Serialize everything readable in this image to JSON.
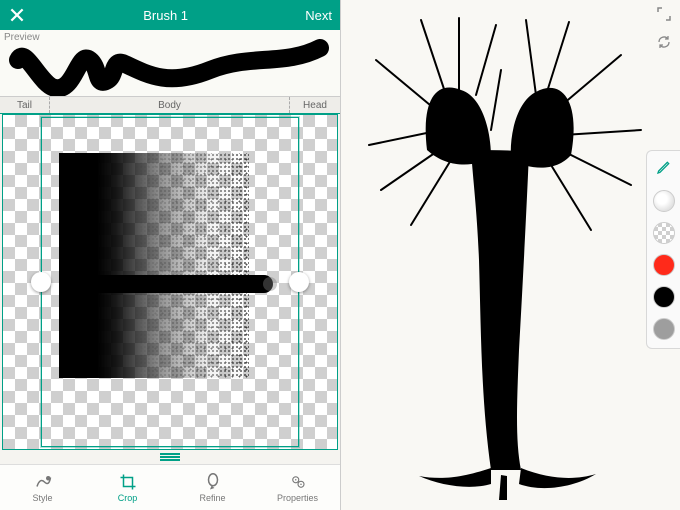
{
  "header": {
    "title": "Brush 1",
    "next_label": "Next"
  },
  "preview": {
    "label": "Preview"
  },
  "segments": {
    "tail": "Tail",
    "body": "Body",
    "head": "Head"
  },
  "toolbar": {
    "items": [
      {
        "label": "Style",
        "active": false
      },
      {
        "label": "Crop",
        "active": true
      },
      {
        "label": "Refine",
        "active": false
      },
      {
        "label": "Properties",
        "active": false
      }
    ]
  },
  "palette": {
    "swatches": [
      {
        "name": "radial-white",
        "css": "radial-gradient(circle at 40% 40%, #fff 30%, #e2e2e2 70%)"
      },
      {
        "name": "checker",
        "css": "repeating-conic-gradient(#cfcfcf 0 25%, #fff 0 50%) 0 0/8px 8px"
      },
      {
        "name": "red",
        "css": "#ff2a1a"
      },
      {
        "name": "black",
        "css": "#000"
      },
      {
        "name": "gray",
        "css": "#9e9e9e"
      }
    ]
  },
  "colors": {
    "accent": "#00a087"
  }
}
